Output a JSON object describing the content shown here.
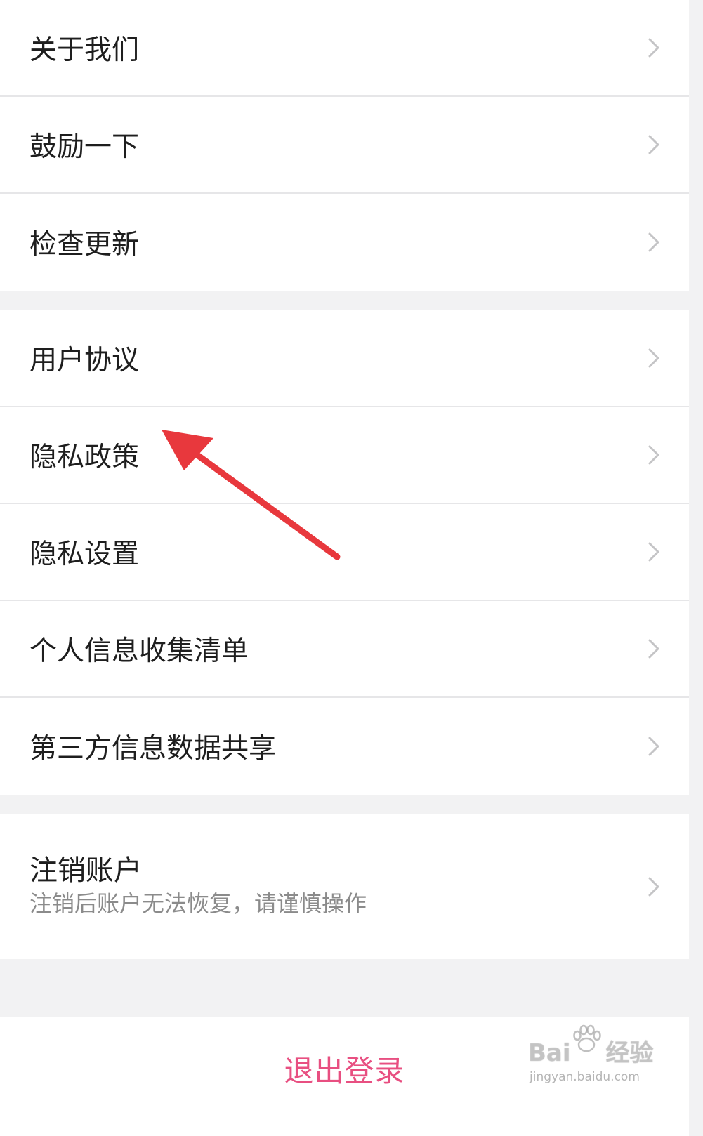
{
  "groups": [
    {
      "items": [
        {
          "label": "关于我们"
        },
        {
          "label": "鼓励一下"
        },
        {
          "label": "检查更新"
        }
      ]
    },
    {
      "items": [
        {
          "label": "用户协议"
        },
        {
          "label": "隐私政策"
        },
        {
          "label": "隐私设置"
        },
        {
          "label": "个人信息收集清单"
        },
        {
          "label": "第三方信息数据共享"
        }
      ]
    },
    {
      "items": [
        {
          "label": "注销账户",
          "subtitle": "注销后账户无法恢复，请谨慎操作"
        }
      ]
    }
  ],
  "logout": {
    "label": "退出登录"
  },
  "colors": {
    "accent": "#e84f81",
    "annotation_arrow": "#e8383d",
    "background": "#f2f2f3"
  },
  "icons": {
    "chevron": "chevron-right-icon"
  },
  "watermark": {
    "brand": "Bai",
    "brand_tail": "经验",
    "url": "jingyan.baidu.com"
  }
}
